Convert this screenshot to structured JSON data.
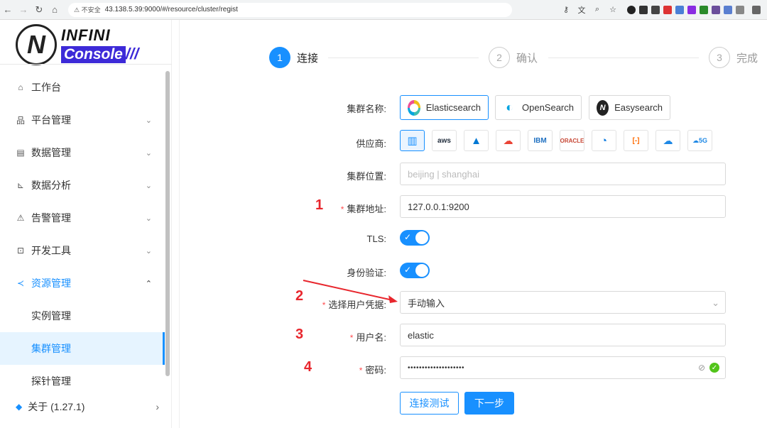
{
  "browser": {
    "url_warning": "⚠ 不安全",
    "url": "43.138.5.39:9000/#/resource/cluster/regist"
  },
  "logo": {
    "line1": "INFINI",
    "line2": "Console",
    "slashes": "///"
  },
  "sidebar": {
    "items": [
      {
        "label": "工作台",
        "icon": "home-icon"
      },
      {
        "label": "平台管理",
        "icon": "cluster-icon"
      },
      {
        "label": "数据管理",
        "icon": "database-icon"
      },
      {
        "label": "数据分析",
        "icon": "chart-icon"
      },
      {
        "label": "告警管理",
        "icon": "alarm-icon"
      },
      {
        "label": "开发工具",
        "icon": "terminal-icon"
      },
      {
        "label": "资源管理",
        "icon": "share-icon"
      }
    ],
    "sub_items": [
      {
        "label": "实例管理"
      },
      {
        "label": "集群管理"
      },
      {
        "label": "探针管理"
      }
    ],
    "about": "关于 (1.27.1)"
  },
  "steps": [
    {
      "num": "1",
      "title": "连接"
    },
    {
      "num": "2",
      "title": "确认"
    },
    {
      "num": "3",
      "title": "完成"
    }
  ],
  "form": {
    "distribution_label": "集群名称:",
    "distributions": [
      "Elasticsearch",
      "OpenSearch",
      "Easysearch"
    ],
    "vendor_label": "供应商:",
    "vendors": [
      "on-prem",
      "aws",
      "azure",
      "gcp",
      "IBM",
      "ORACLE",
      "huawei",
      "alibaba",
      "tencent",
      "5g"
    ],
    "location_label": "集群位置:",
    "location_placeholder": "beijing | shanghai",
    "address_label": "集群地址:",
    "address_value": "127.0.0.1:9200",
    "tls_label": "TLS:",
    "auth_label": "身份验证:",
    "credential_label": "选择用户凭据:",
    "credential_value": "手动输入",
    "username_label": "用户名:",
    "username_value": "elastic",
    "password_label": "密码:",
    "password_value": "••••••••••••••••••••",
    "required_mark": "*"
  },
  "buttons": {
    "test": "连接测试",
    "next": "下一步"
  },
  "annotations": [
    "1",
    "2",
    "3",
    "4"
  ],
  "colors": {
    "primary": "#1890ff",
    "annotation": "#e8262d",
    "brand": "#3d2ad8"
  }
}
